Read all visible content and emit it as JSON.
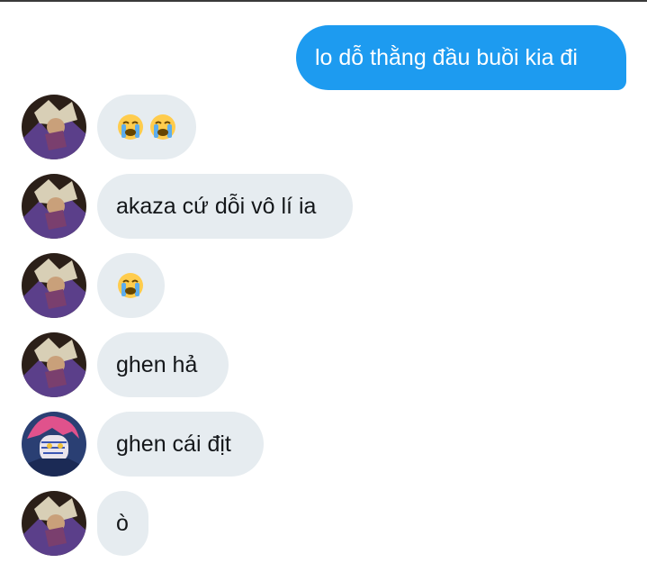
{
  "messages": [
    {
      "side": "sent",
      "text": "lo dỗ thằng đầu buồi kia đi"
    },
    {
      "side": "recv",
      "avatar": "a",
      "emoji": [
        "loudly-crying-face-icon",
        "loudly-crying-face-icon"
      ],
      "text": "😭😭"
    },
    {
      "side": "recv",
      "avatar": "a",
      "text": "akaza cứ dỗi vô lí ia"
    },
    {
      "side": "recv",
      "avatar": "a",
      "emoji": [
        "loudly-crying-face-icon"
      ],
      "text": "😭"
    },
    {
      "side": "recv",
      "avatar": "a",
      "text": "ghen hả"
    },
    {
      "side": "recv",
      "avatar": "b",
      "text": "ghen cái địt"
    },
    {
      "side": "recv",
      "avatar": "a",
      "text": "ò"
    }
  ],
  "colors": {
    "sent_bubble": "#1d9bf0",
    "recv_bubble": "#e6ecf0",
    "sent_text": "#ffffff",
    "recv_text": "#14171a"
  }
}
